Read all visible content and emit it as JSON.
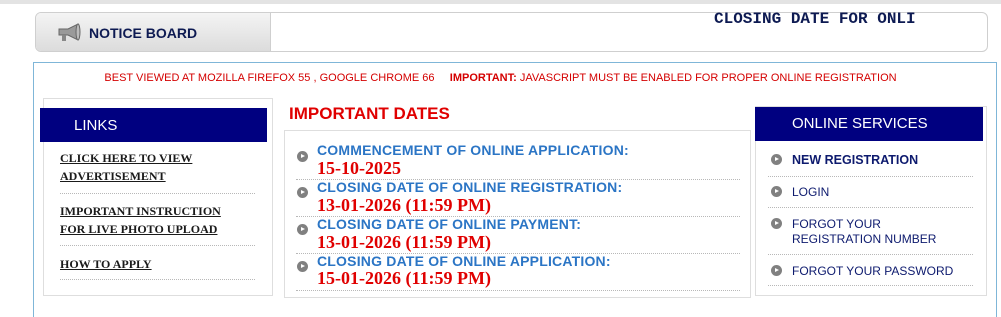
{
  "notice_board": {
    "title": "NOTICE BOARD",
    "ticker": "CLOSING DATE FOR ONLI"
  },
  "browser_note": {
    "text": "BEST VIEWED AT MOZILLA FIREFOX 55 , GOOGLE CHROME 66",
    "important_label": "IMPORTANT:",
    "important_text": "JAVASCRIPT MUST BE ENABLED FOR PROPER ONLINE REGISTRATION"
  },
  "links": {
    "heading": "LINKS",
    "items": [
      {
        "line1": "CLICK HERE TO VIEW",
        "line2": "ADVERTISEMENT"
      },
      {
        "line1": "IMPORTANT INSTRUCTION",
        "line2": "FOR LIVE PHOTO UPLOAD"
      },
      {
        "line1": "HOW TO APPLY"
      }
    ]
  },
  "important_dates": {
    "heading": "IMPORTANT DATES",
    "items": [
      {
        "label": "COMMENCEMENT OF ONLINE APPLICATION:",
        "value": "15-10-2025"
      },
      {
        "label": "CLOSING DATE OF ONLINE REGISTRATION:",
        "value": "13-01-2026 (11:59 PM)"
      },
      {
        "label": "CLOSING DATE OF ONLINE PAYMENT:",
        "value": "13-01-2026 (11:59 PM)"
      },
      {
        "label": "CLOSING DATE OF ONLINE APPLICATION:",
        "value": "15-01-2026 (11:59 PM)"
      }
    ]
  },
  "online_services": {
    "heading": "ONLINE SERVICES",
    "items": [
      {
        "line1": "NEW REGISTRATION"
      },
      {
        "line1": "LOGIN"
      },
      {
        "line1": "FORGOT YOUR",
        "line2": "REGISTRATION NUMBER"
      },
      {
        "line1": "FORGOT YOUR PASSWORD"
      }
    ]
  },
  "colors": {
    "header_navy": "#000080",
    "date_label_blue": "#2b75c5",
    "alert_red": "#e00000"
  },
  "icons": {
    "notice": "megaphone-icon",
    "bullet": "circle-arrow-icon"
  }
}
